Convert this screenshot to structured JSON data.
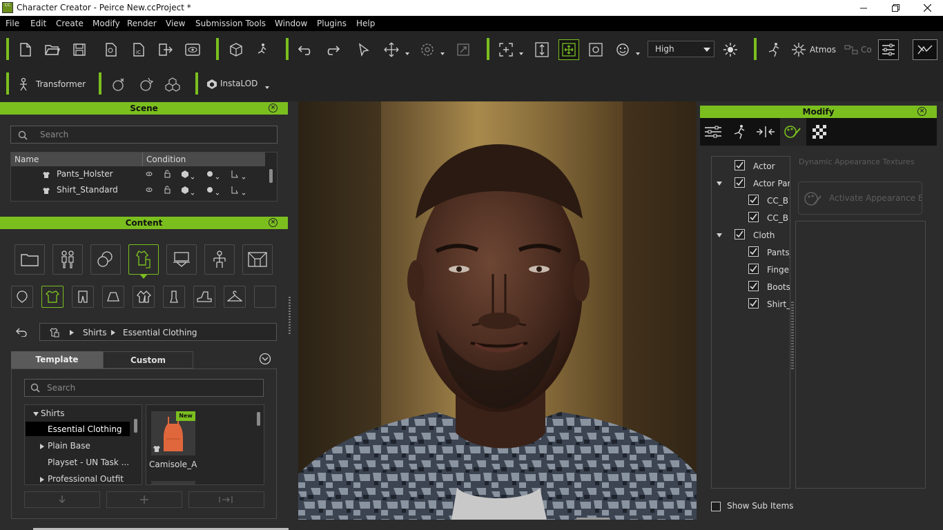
{
  "window": {
    "title": "Character Creator - Peirce New.ccProject *",
    "logo_text": "CC"
  },
  "menu": [
    "File",
    "Edit",
    "Create",
    "Modify",
    "Render",
    "View",
    "Submission Tools",
    "Window",
    "Plugins",
    "Help"
  ],
  "toolbar": {
    "quality": "High",
    "atmos_label": "Atmos",
    "co_label": "Co",
    "transformer_label": "Transformer",
    "instalod_label": "InstaLOD"
  },
  "scene": {
    "title": "Scene",
    "search_placeholder": "Search",
    "columns": [
      "Name",
      "Condition"
    ],
    "rows": [
      {
        "name": "Pants_Holster"
      },
      {
        "name": "Shirt_Standard"
      }
    ]
  },
  "content": {
    "title": "Content",
    "breadcrumb": [
      "Shirts",
      "Essential Clothing"
    ],
    "tabs": [
      "Template",
      "Custom"
    ],
    "search_placeholder": "Search",
    "tree": {
      "root": "Shirts",
      "items": [
        "Essential Clothing",
        "Plain Base",
        "Playset - UN Task ...",
        "Professional Outfit"
      ]
    },
    "items": [
      {
        "name": "Camisole_A",
        "badge": "New"
      }
    ]
  },
  "modify": {
    "title": "Modify",
    "tree": [
      {
        "label": "Actor",
        "checked": true
      },
      {
        "label": "Actor Parts",
        "checked": true
      },
      {
        "label": "CC_B",
        "checked": true
      },
      {
        "label": "CC_B",
        "checked": true
      },
      {
        "label": "Cloth",
        "checked": true
      },
      {
        "label": "Pants_",
        "checked": true
      },
      {
        "label": "Finger",
        "checked": true
      },
      {
        "label": "Boots",
        "checked": true
      },
      {
        "label": "Shirt_S",
        "checked": true
      }
    ],
    "dynamic_label": "Dynamic Appearance Textures",
    "activate_button": "Activate Appearance Edit",
    "show_sub_items": "Show Sub Items"
  },
  "colors": {
    "accent": "#7bbf1f",
    "panel_bg": "#2c2c2c",
    "toolbar_bg": "#242424"
  }
}
